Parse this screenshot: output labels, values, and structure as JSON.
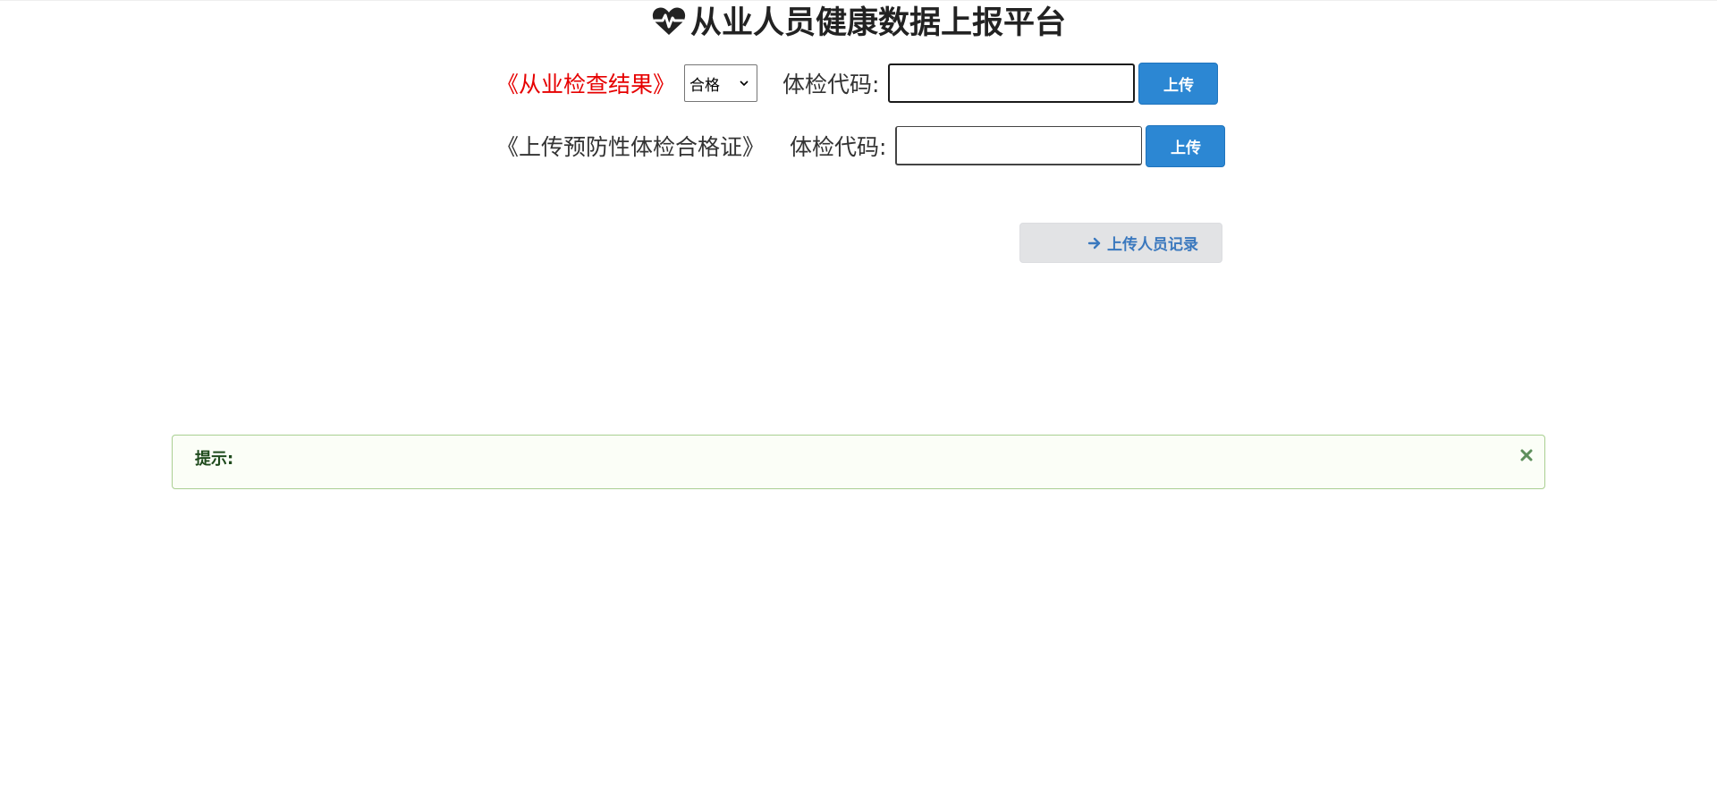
{
  "header": {
    "title": "从业人员健康数据上报平台",
    "icon": "heartbeat-icon"
  },
  "row1": {
    "label": "《从业检查结果》",
    "select_value": "合格",
    "code_label": "体检代码:",
    "code_value": "",
    "upload_label": "上传"
  },
  "row2": {
    "label": "《上传预防性体检合格证》",
    "code_label": "体检代码:",
    "code_value": "",
    "upload_label": "上传"
  },
  "records_button": {
    "label": "上传人员记录",
    "icon": "arrow-right-icon"
  },
  "alert": {
    "label": "提示:",
    "close_icon": "close-icon"
  },
  "colors": {
    "primary": "#2c87d3",
    "danger": "#e60000",
    "alert_bg": "#fbfef7",
    "alert_border": "#a9cf92",
    "alert_text": "#1e4a1c",
    "secondary_bg": "#e2e3e5",
    "secondary_text": "#3a78be"
  }
}
